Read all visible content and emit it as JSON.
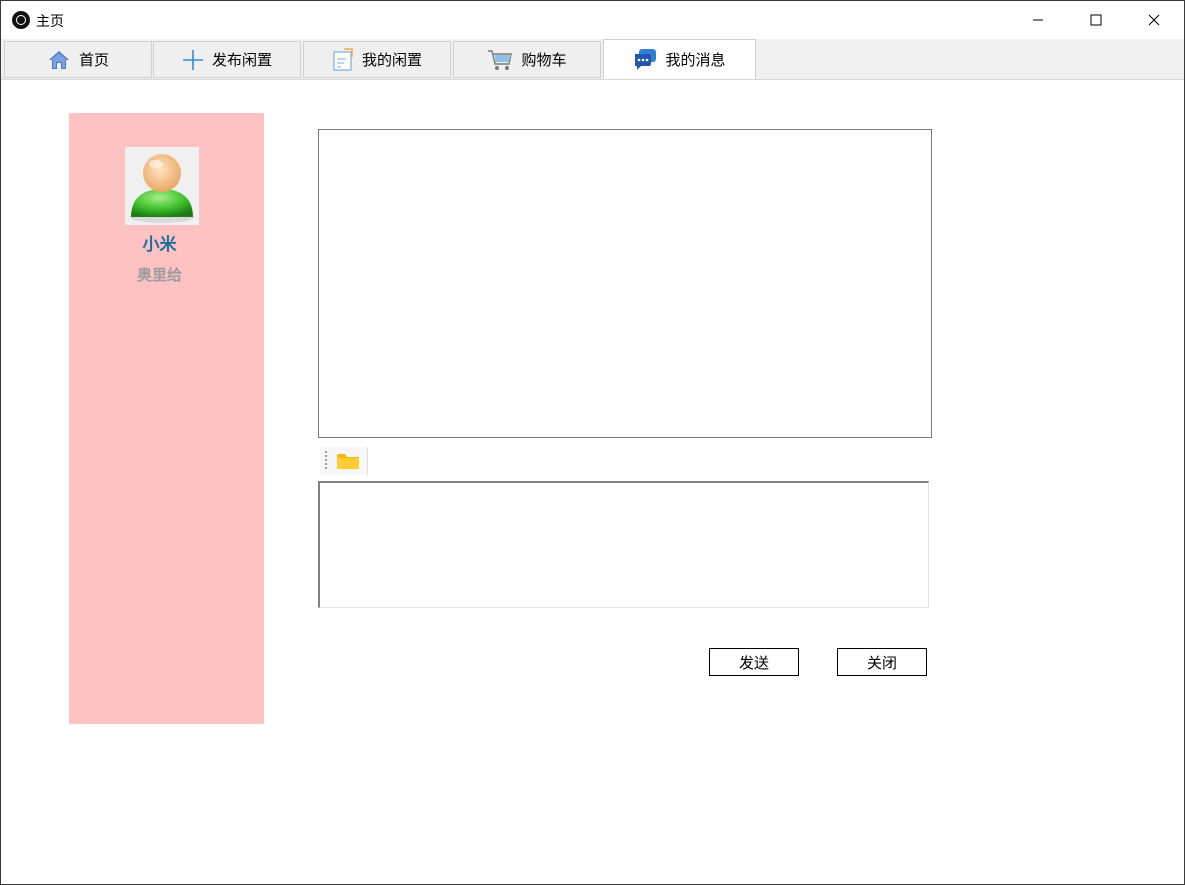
{
  "window": {
    "title": "主页"
  },
  "tabs": [
    {
      "label": "首页",
      "icon": "home-icon",
      "active": false
    },
    {
      "label": "发布闲置",
      "icon": "plus-icon",
      "active": false
    },
    {
      "label": "我的闲置",
      "icon": "document-icon",
      "active": false
    },
    {
      "label": "购物车",
      "icon": "cart-icon",
      "active": false
    },
    {
      "label": "我的消息",
      "icon": "chat-icon",
      "active": true
    }
  ],
  "contact": {
    "name": "小米",
    "subtitle": "奥里给"
  },
  "chat": {
    "log_text": "",
    "input_value": ""
  },
  "buttons": {
    "send_label": "发送",
    "close_label": "关闭"
  },
  "colors": {
    "sidebar_bg": "#ffc2c2",
    "contact_name": "#1d6fa0",
    "contact_subtitle": "#9c9c9c"
  }
}
